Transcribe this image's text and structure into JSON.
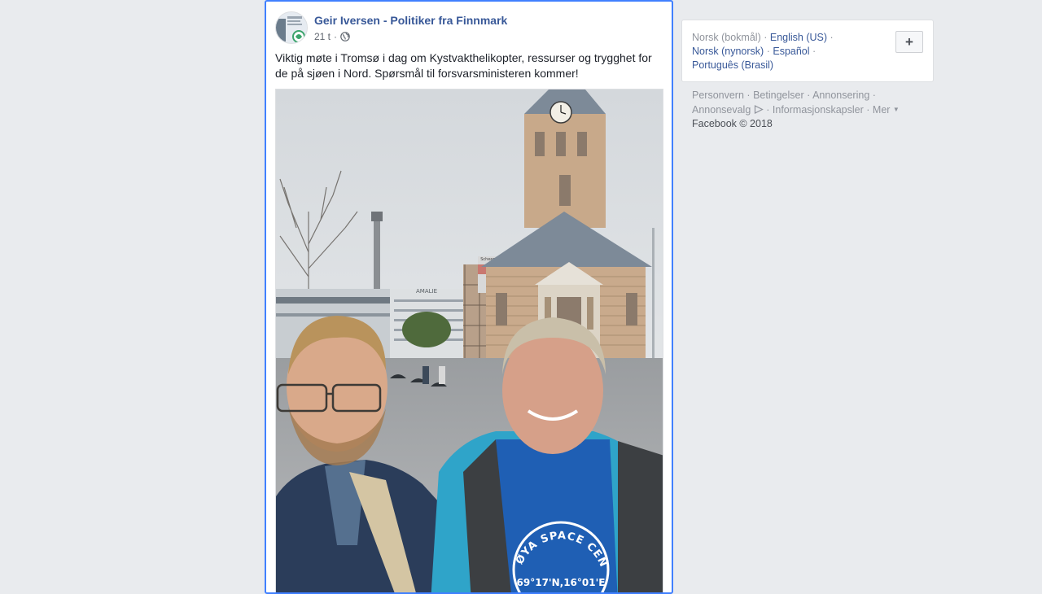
{
  "post": {
    "author": "Geir Iversen - Politiker fra Finnmark",
    "time": "21 t",
    "meta_sep": "·",
    "privacy_icon": "globe-icon",
    "text": "Viktig møte i Tromsø i dag om Kystvakthelikopter, ressurser og trygghet for de på sjøen i Nord. Spørsmål til forsvarsministeren kommer!",
    "photo": {
      "church_sign": "Scheene",
      "building_sign": "AMALIE",
      "shirt_text": "ANDØYA SPACE CENTER",
      "shirt_coords": "69°17'N,16°01'E"
    }
  },
  "sidebar": {
    "languages": {
      "current": "Norsk (bokmål)",
      "items": [
        "English (US)",
        "Norsk (nynorsk)",
        "Español",
        "Português (Brasil)"
      ],
      "separator": "·",
      "add_button": "+"
    },
    "footer": {
      "links": [
        "Personvern",
        "Betingelser",
        "Annonsering",
        "Annonsevalg",
        "Informasjonskapsler",
        "Mer"
      ],
      "separator": "·",
      "copyright": "Facebook © 2018"
    }
  },
  "colors": {
    "link": "#385898",
    "muted": "#90949c",
    "focus_border": "#4080ff",
    "background": "#e9ebee"
  }
}
